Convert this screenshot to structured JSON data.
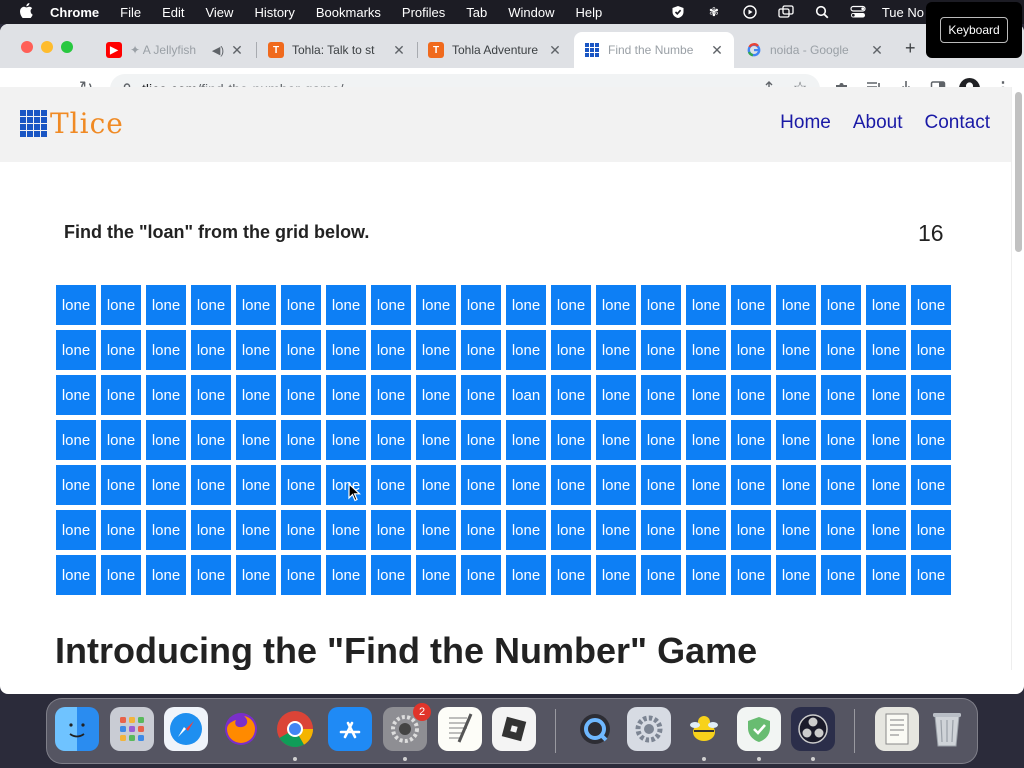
{
  "menubar": {
    "app_name": "Chrome",
    "items": [
      "File",
      "Edit",
      "View",
      "History",
      "Bookmarks",
      "Profiles",
      "Tab",
      "Window",
      "Help"
    ],
    "clock": "Tue No"
  },
  "keyboard_overlay": "Keyboard",
  "tabs": [
    {
      "title": "✦ A Jellyfish",
      "favicon": "youtube-icon",
      "audio": true
    },
    {
      "title": "Tohla: Talk to st",
      "favicon": "tohla-icon"
    },
    {
      "title": "Tohla Adventure",
      "favicon": "tohla-icon"
    },
    {
      "title": "Find the Numbe",
      "favicon": "tlice-icon",
      "active": true
    },
    {
      "title": "noida - Google",
      "favicon": "google-icon"
    }
  ],
  "omnibox": {
    "domain": "tlice.com",
    "path": "/find-the-number-game/"
  },
  "site": {
    "logo_text": "Tlice",
    "nav": [
      "Home",
      "About",
      "Contact"
    ]
  },
  "game": {
    "prompt": "Find the \"loan\" from the grid below.",
    "score": "16",
    "rows": 7,
    "cols": 20,
    "filler_word": "lone",
    "target_word": "loan",
    "target_row": 2,
    "target_col": 10
  },
  "intro_heading": "Introducing the \"Find the Number\" Game",
  "dock": {
    "apps": [
      "finder-icon",
      "launchpad-icon",
      "safari-icon",
      "firefox-icon",
      "chrome-icon",
      "app-store-icon",
      "system-preferences-icon",
      "textedit-icon",
      "roblox-icon",
      "quicktime-icon",
      "settings-gear-icon",
      "cyberduck-icon",
      "adguard-icon",
      "obs-icon",
      "script-editor-icon",
      "trash-icon"
    ],
    "settings_badge": "2"
  },
  "colors": {
    "cell_blue": "#0d7ff5",
    "logo_orange": "#f08a24",
    "nav_blue": "#1a1aa6"
  }
}
